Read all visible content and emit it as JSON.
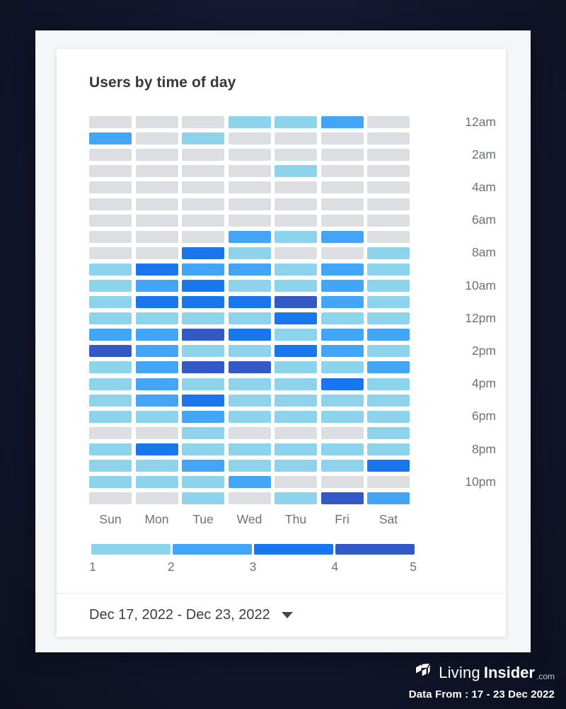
{
  "chart": {
    "title": "Users by time of day"
  },
  "footer": {
    "date_range": "Dec 17, 2022 - Dec 23, 2022",
    "caret_icon": "chevron-down-icon"
  },
  "branding": {
    "logo_icon": "cube-logo-icon",
    "name_light": "Living",
    "name_bold": "Insider",
    "tld": ".com",
    "data_from": "Data From : 17 - 23 Dec 2022"
  },
  "colors": {
    "background": "#12152b",
    "panel": "#f5f6f8",
    "card": "#ffffff",
    "title_text": "#34373d",
    "axis_text": "#6d7278",
    "level_0": "#dcdee1",
    "level_1": "#8dd3ec",
    "level_2": "#42a5f5",
    "level_3": "#1976ed",
    "level_4": "#3359c6"
  },
  "chart_data": {
    "type": "heatmap",
    "title": "Users by time of day",
    "xlabel": "",
    "ylabel": "",
    "grid": false,
    "legend_position": "bottom",
    "categories": [
      "Sun",
      "Mon",
      "Tue",
      "Wed",
      "Thu",
      "Fri",
      "Sat"
    ],
    "y_categories": [
      "12am",
      "1am",
      "2am",
      "3am",
      "4am",
      "5am",
      "6am",
      "7am",
      "8am",
      "9am",
      "10am",
      "11am",
      "12pm",
      "1pm",
      "2pm",
      "3pm",
      "4pm",
      "5pm",
      "6pm",
      "7pm",
      "8pm",
      "9pm",
      "10pm",
      "11pm"
    ],
    "y_tick_labels": [
      "12am",
      "2am",
      "4am",
      "6am",
      "8am",
      "10am",
      "12pm",
      "2pm",
      "4pm",
      "6pm",
      "8pm",
      "10pm"
    ],
    "legend": {
      "ticks": [
        "1",
        "2",
        "3",
        "4",
        "5"
      ],
      "bands": [
        "#8dd3ec",
        "#42a5f5",
        "#1976ed",
        "#3359c6"
      ],
      "zlim": [
        1,
        5
      ]
    },
    "zlim": [
      0,
      5
    ],
    "color_scale": [
      "#dcdee1",
      "#8dd3ec",
      "#42a5f5",
      "#1976ed",
      "#3359c6"
    ],
    "values": [
      [
        0,
        0,
        0,
        1,
        1,
        2,
        0
      ],
      [
        2,
        0,
        1,
        0,
        0,
        0,
        0
      ],
      [
        0,
        0,
        0,
        0,
        0,
        0,
        0
      ],
      [
        0,
        0,
        0,
        0,
        1,
        0,
        0
      ],
      [
        0,
        0,
        0,
        0,
        0,
        0,
        0
      ],
      [
        0,
        0,
        0,
        0,
        0,
        0,
        0
      ],
      [
        0,
        0,
        0,
        0,
        0,
        0,
        0
      ],
      [
        0,
        0,
        0,
        2,
        1,
        2,
        0
      ],
      [
        0,
        0,
        3,
        1,
        0,
        0,
        1
      ],
      [
        1,
        3,
        2,
        2,
        1,
        2,
        1
      ],
      [
        1,
        2,
        3,
        1,
        1,
        2,
        1
      ],
      [
        1,
        3,
        3,
        3,
        4,
        2,
        1
      ],
      [
        1,
        1,
        1,
        1,
        3,
        1,
        1
      ],
      [
        2,
        2,
        4,
        3,
        1,
        2,
        2
      ],
      [
        4,
        2,
        1,
        1,
        3,
        2,
        1
      ],
      [
        1,
        2,
        4,
        4,
        1,
        1,
        2
      ],
      [
        1,
        2,
        1,
        1,
        1,
        3,
        1
      ],
      [
        1,
        2,
        3,
        1,
        1,
        1,
        1
      ],
      [
        1,
        1,
        2,
        1,
        1,
        1,
        1
      ],
      [
        0,
        0,
        1,
        0,
        0,
        0,
        1
      ],
      [
        1,
        3,
        1,
        1,
        1,
        1,
        1
      ],
      [
        1,
        1,
        2,
        1,
        1,
        1,
        3
      ],
      [
        1,
        1,
        1,
        2,
        0,
        0,
        0
      ],
      [
        0,
        0,
        1,
        0,
        1,
        4,
        2
      ]
    ]
  }
}
